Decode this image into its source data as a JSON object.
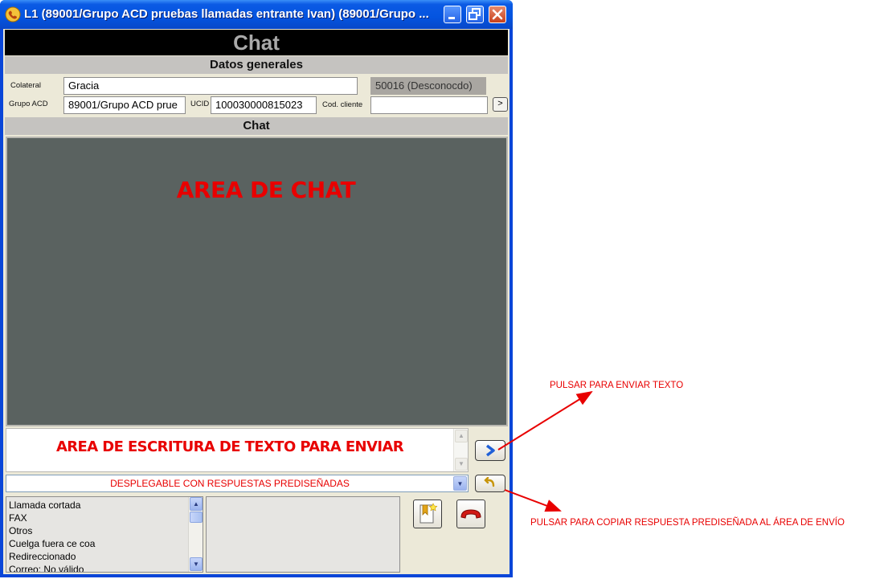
{
  "window": {
    "title": "L1 (89001/Grupo ACD pruebas llamadas entrante Ivan) (89001/Grupo ..."
  },
  "header": {
    "title": "Chat"
  },
  "general": {
    "section_title": "Datos generales",
    "collateral_label": "Colateral",
    "collateral_value": "Gracia",
    "collateral_status": "50016 (Desconocdo)",
    "acd_group_label": "Grupo ACD",
    "acd_group_value": "89001/Grupo ACD prue",
    "ucid_label": "UCID",
    "ucid_value": "100030000815023",
    "customer_code_label": "Cod. cliente",
    "customer_code_value": "",
    "customer_code_button": ">"
  },
  "chat": {
    "section_title": "Chat",
    "area_label": "AREA DE CHAT",
    "compose_label": "AREA DE ESCRITURA DE TEXTO PARA ENVIAR",
    "send_icon": "send-arrow-icon",
    "canned_select_label": "DESPLEGABLE CON RESPUESTAS PREDISEÑADAS",
    "copy_icon": "copy-response-icon"
  },
  "closure_reasons": [
    "Llamada cortada",
    "FAX",
    "Otros",
    "Cuelga fuera ce coa",
    "Redireccionado",
    "Correo: No válido"
  ],
  "annotations": {
    "send": "PULSAR PARA ENVIAR TEXTO",
    "copy": "PULSAR PARA COPIAR RESPUESTA PREDISEÑADA AL ÁREA DE ENVÍO"
  },
  "colors": {
    "annotation": "#e80000",
    "chat_background": "#5a6260",
    "titlebar": "#0454e0"
  }
}
